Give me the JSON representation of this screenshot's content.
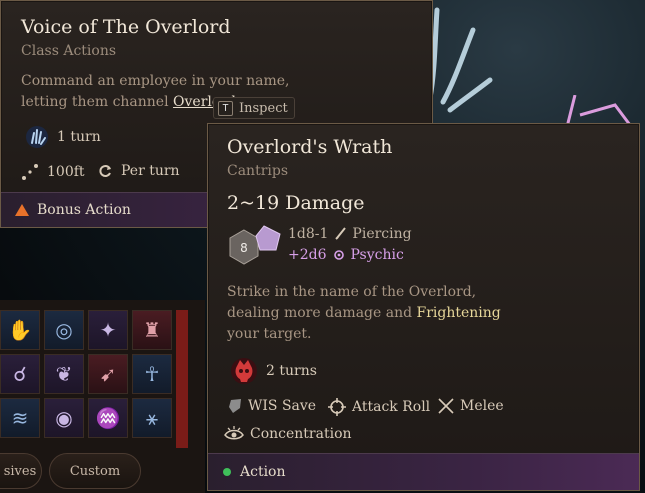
{
  "card1": {
    "title": "Voice of The Overlord",
    "subtitle": "Class Actions",
    "desc_line1": "Command an employee in your name,",
    "desc_line2_prefix": "letting them channel ",
    "desc_line2_link": "Overlord",
    "duration_icon": "hand-spell-icon",
    "duration": "1 turn",
    "range_icon": "range-dots-icon",
    "range": "100ft",
    "cooldown_icon": "refresh-icon",
    "cooldown": "Per turn",
    "action_icon": "bonus-action-triangle-icon",
    "action": "Bonus Action"
  },
  "inspect": {
    "key": "T",
    "label": "Inspect"
  },
  "card2": {
    "title": "Overlord's Wrath",
    "subtitle": "Cantrips",
    "damage_range": "2~19 Damage",
    "dice_icon": "d8-d6-dice-icon",
    "dice_number": "8",
    "dmg1_dice": "1d8-1",
    "dmg1_icon": "piercing-icon",
    "dmg1_type": "Piercing",
    "dmg2_dice": "+2d6",
    "dmg2_icon": "psychic-icon",
    "dmg2_type": "Psychic",
    "desc_line1": "Strike in the name of the Overlord,",
    "desc_line2_prefix": "dealing more damage and ",
    "desc_line2_highlight": "Frightening",
    "desc_line3": "your target.",
    "condition_icon": "frightened-skull-icon",
    "condition_duration": "2 turns",
    "save_icon": "shield-icon",
    "save": "WIS Save",
    "roll_icon": "crosshair-icon",
    "roll": "Attack Roll",
    "melee_icon": "crossed-swords-icon",
    "melee": "Melee",
    "conc_icon": "eye-concentration-icon",
    "concentration": "Concentration",
    "action_icon": "action-dot-icon",
    "action": "Action"
  },
  "hotbar": {
    "tab1": "sives",
    "tab2": "Custom"
  },
  "colors": {
    "bonus_action": "#e8722a",
    "action": "#3fbf5a",
    "psychic": "#d8a0e8",
    "frightened": "#d23a3a",
    "highlight": "#e7d79a"
  }
}
